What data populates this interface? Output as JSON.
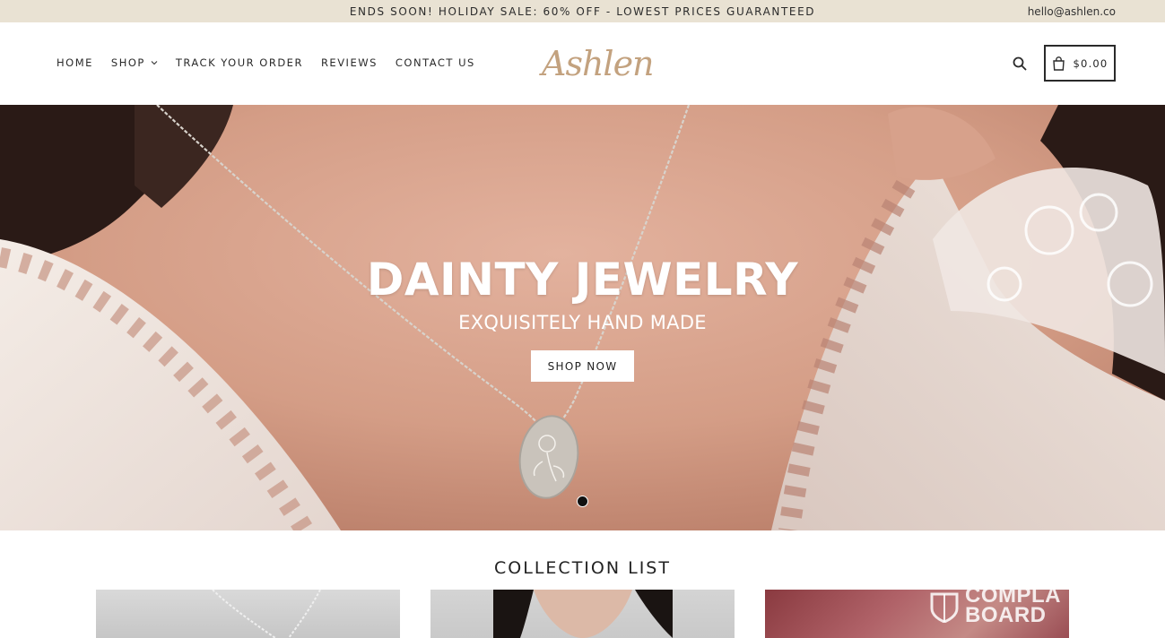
{
  "announcement": {
    "text": "ENDS SOON! HOLIDAY SALE: 60% OFF - LOWEST PRICES GUARANTEED",
    "email": "hello@ashlen.co"
  },
  "header": {
    "nav": [
      {
        "label": "HOME"
      },
      {
        "label": "SHOP",
        "has_dropdown": true
      },
      {
        "label": "TRACK YOUR ORDER"
      },
      {
        "label": "REVIEWS"
      },
      {
        "label": "CONTACT US"
      }
    ],
    "logo": "Ashlen",
    "search_icon": "search-icon",
    "cart_icon": "shopping-bag-icon",
    "cart_total": "$0.00"
  },
  "hero": {
    "title": "DAINTY JEWELRY",
    "subtitle": "EXQUISITELY HAND MADE",
    "cta": "SHOP NOW",
    "slide_count": 1,
    "active_slide": 1
  },
  "collection": {
    "title": "COLLECTION LIST",
    "badge_line1": "COMPLA",
    "badge_line2": "BOARD"
  },
  "colors": {
    "announcement_bg": "#e9e2d3",
    "logo": "#c3a27f",
    "text": "#2a2a2a"
  }
}
